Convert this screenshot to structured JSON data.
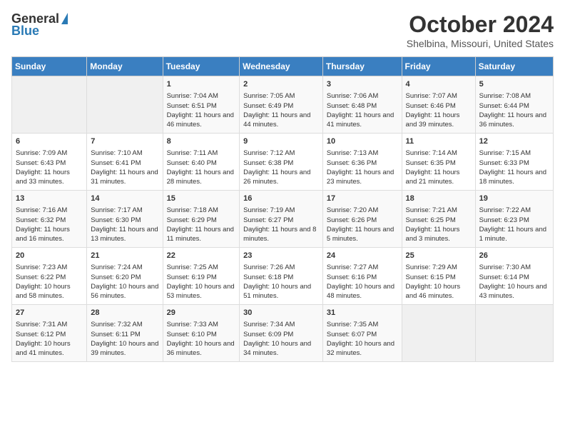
{
  "logo": {
    "general": "General",
    "blue": "Blue"
  },
  "title": {
    "month": "October 2024",
    "location": "Shelbina, Missouri, United States"
  },
  "headers": [
    "Sunday",
    "Monday",
    "Tuesday",
    "Wednesday",
    "Thursday",
    "Friday",
    "Saturday"
  ],
  "weeks": [
    [
      {
        "day": "",
        "empty": true
      },
      {
        "day": "",
        "empty": true
      },
      {
        "day": "1",
        "sunrise": "Sunrise: 7:04 AM",
        "sunset": "Sunset: 6:51 PM",
        "daylight": "Daylight: 11 hours and 46 minutes."
      },
      {
        "day": "2",
        "sunrise": "Sunrise: 7:05 AM",
        "sunset": "Sunset: 6:49 PM",
        "daylight": "Daylight: 11 hours and 44 minutes."
      },
      {
        "day": "3",
        "sunrise": "Sunrise: 7:06 AM",
        "sunset": "Sunset: 6:48 PM",
        "daylight": "Daylight: 11 hours and 41 minutes."
      },
      {
        "day": "4",
        "sunrise": "Sunrise: 7:07 AM",
        "sunset": "Sunset: 6:46 PM",
        "daylight": "Daylight: 11 hours and 39 minutes."
      },
      {
        "day": "5",
        "sunrise": "Sunrise: 7:08 AM",
        "sunset": "Sunset: 6:44 PM",
        "daylight": "Daylight: 11 hours and 36 minutes."
      }
    ],
    [
      {
        "day": "6",
        "sunrise": "Sunrise: 7:09 AM",
        "sunset": "Sunset: 6:43 PM",
        "daylight": "Daylight: 11 hours and 33 minutes."
      },
      {
        "day": "7",
        "sunrise": "Sunrise: 7:10 AM",
        "sunset": "Sunset: 6:41 PM",
        "daylight": "Daylight: 11 hours and 31 minutes."
      },
      {
        "day": "8",
        "sunrise": "Sunrise: 7:11 AM",
        "sunset": "Sunset: 6:40 PM",
        "daylight": "Daylight: 11 hours and 28 minutes."
      },
      {
        "day": "9",
        "sunrise": "Sunrise: 7:12 AM",
        "sunset": "Sunset: 6:38 PM",
        "daylight": "Daylight: 11 hours and 26 minutes."
      },
      {
        "day": "10",
        "sunrise": "Sunrise: 7:13 AM",
        "sunset": "Sunset: 6:36 PM",
        "daylight": "Daylight: 11 hours and 23 minutes."
      },
      {
        "day": "11",
        "sunrise": "Sunrise: 7:14 AM",
        "sunset": "Sunset: 6:35 PM",
        "daylight": "Daylight: 11 hours and 21 minutes."
      },
      {
        "day": "12",
        "sunrise": "Sunrise: 7:15 AM",
        "sunset": "Sunset: 6:33 PM",
        "daylight": "Daylight: 11 hours and 18 minutes."
      }
    ],
    [
      {
        "day": "13",
        "sunrise": "Sunrise: 7:16 AM",
        "sunset": "Sunset: 6:32 PM",
        "daylight": "Daylight: 11 hours and 16 minutes."
      },
      {
        "day": "14",
        "sunrise": "Sunrise: 7:17 AM",
        "sunset": "Sunset: 6:30 PM",
        "daylight": "Daylight: 11 hours and 13 minutes."
      },
      {
        "day": "15",
        "sunrise": "Sunrise: 7:18 AM",
        "sunset": "Sunset: 6:29 PM",
        "daylight": "Daylight: 11 hours and 11 minutes."
      },
      {
        "day": "16",
        "sunrise": "Sunrise: 7:19 AM",
        "sunset": "Sunset: 6:27 PM",
        "daylight": "Daylight: 11 hours and 8 minutes."
      },
      {
        "day": "17",
        "sunrise": "Sunrise: 7:20 AM",
        "sunset": "Sunset: 6:26 PM",
        "daylight": "Daylight: 11 hours and 5 minutes."
      },
      {
        "day": "18",
        "sunrise": "Sunrise: 7:21 AM",
        "sunset": "Sunset: 6:25 PM",
        "daylight": "Daylight: 11 hours and 3 minutes."
      },
      {
        "day": "19",
        "sunrise": "Sunrise: 7:22 AM",
        "sunset": "Sunset: 6:23 PM",
        "daylight": "Daylight: 11 hours and 1 minute."
      }
    ],
    [
      {
        "day": "20",
        "sunrise": "Sunrise: 7:23 AM",
        "sunset": "Sunset: 6:22 PM",
        "daylight": "Daylight: 10 hours and 58 minutes."
      },
      {
        "day": "21",
        "sunrise": "Sunrise: 7:24 AM",
        "sunset": "Sunset: 6:20 PM",
        "daylight": "Daylight: 10 hours and 56 minutes."
      },
      {
        "day": "22",
        "sunrise": "Sunrise: 7:25 AM",
        "sunset": "Sunset: 6:19 PM",
        "daylight": "Daylight: 10 hours and 53 minutes."
      },
      {
        "day": "23",
        "sunrise": "Sunrise: 7:26 AM",
        "sunset": "Sunset: 6:18 PM",
        "daylight": "Daylight: 10 hours and 51 minutes."
      },
      {
        "day": "24",
        "sunrise": "Sunrise: 7:27 AM",
        "sunset": "Sunset: 6:16 PM",
        "daylight": "Daylight: 10 hours and 48 minutes."
      },
      {
        "day": "25",
        "sunrise": "Sunrise: 7:29 AM",
        "sunset": "Sunset: 6:15 PM",
        "daylight": "Daylight: 10 hours and 46 minutes."
      },
      {
        "day": "26",
        "sunrise": "Sunrise: 7:30 AM",
        "sunset": "Sunset: 6:14 PM",
        "daylight": "Daylight: 10 hours and 43 minutes."
      }
    ],
    [
      {
        "day": "27",
        "sunrise": "Sunrise: 7:31 AM",
        "sunset": "Sunset: 6:12 PM",
        "daylight": "Daylight: 10 hours and 41 minutes."
      },
      {
        "day": "28",
        "sunrise": "Sunrise: 7:32 AM",
        "sunset": "Sunset: 6:11 PM",
        "daylight": "Daylight: 10 hours and 39 minutes."
      },
      {
        "day": "29",
        "sunrise": "Sunrise: 7:33 AM",
        "sunset": "Sunset: 6:10 PM",
        "daylight": "Daylight: 10 hours and 36 minutes."
      },
      {
        "day": "30",
        "sunrise": "Sunrise: 7:34 AM",
        "sunset": "Sunset: 6:09 PM",
        "daylight": "Daylight: 10 hours and 34 minutes."
      },
      {
        "day": "31",
        "sunrise": "Sunrise: 7:35 AM",
        "sunset": "Sunset: 6:07 PM",
        "daylight": "Daylight: 10 hours and 32 minutes."
      },
      {
        "day": "",
        "empty": true
      },
      {
        "day": "",
        "empty": true
      }
    ]
  ]
}
